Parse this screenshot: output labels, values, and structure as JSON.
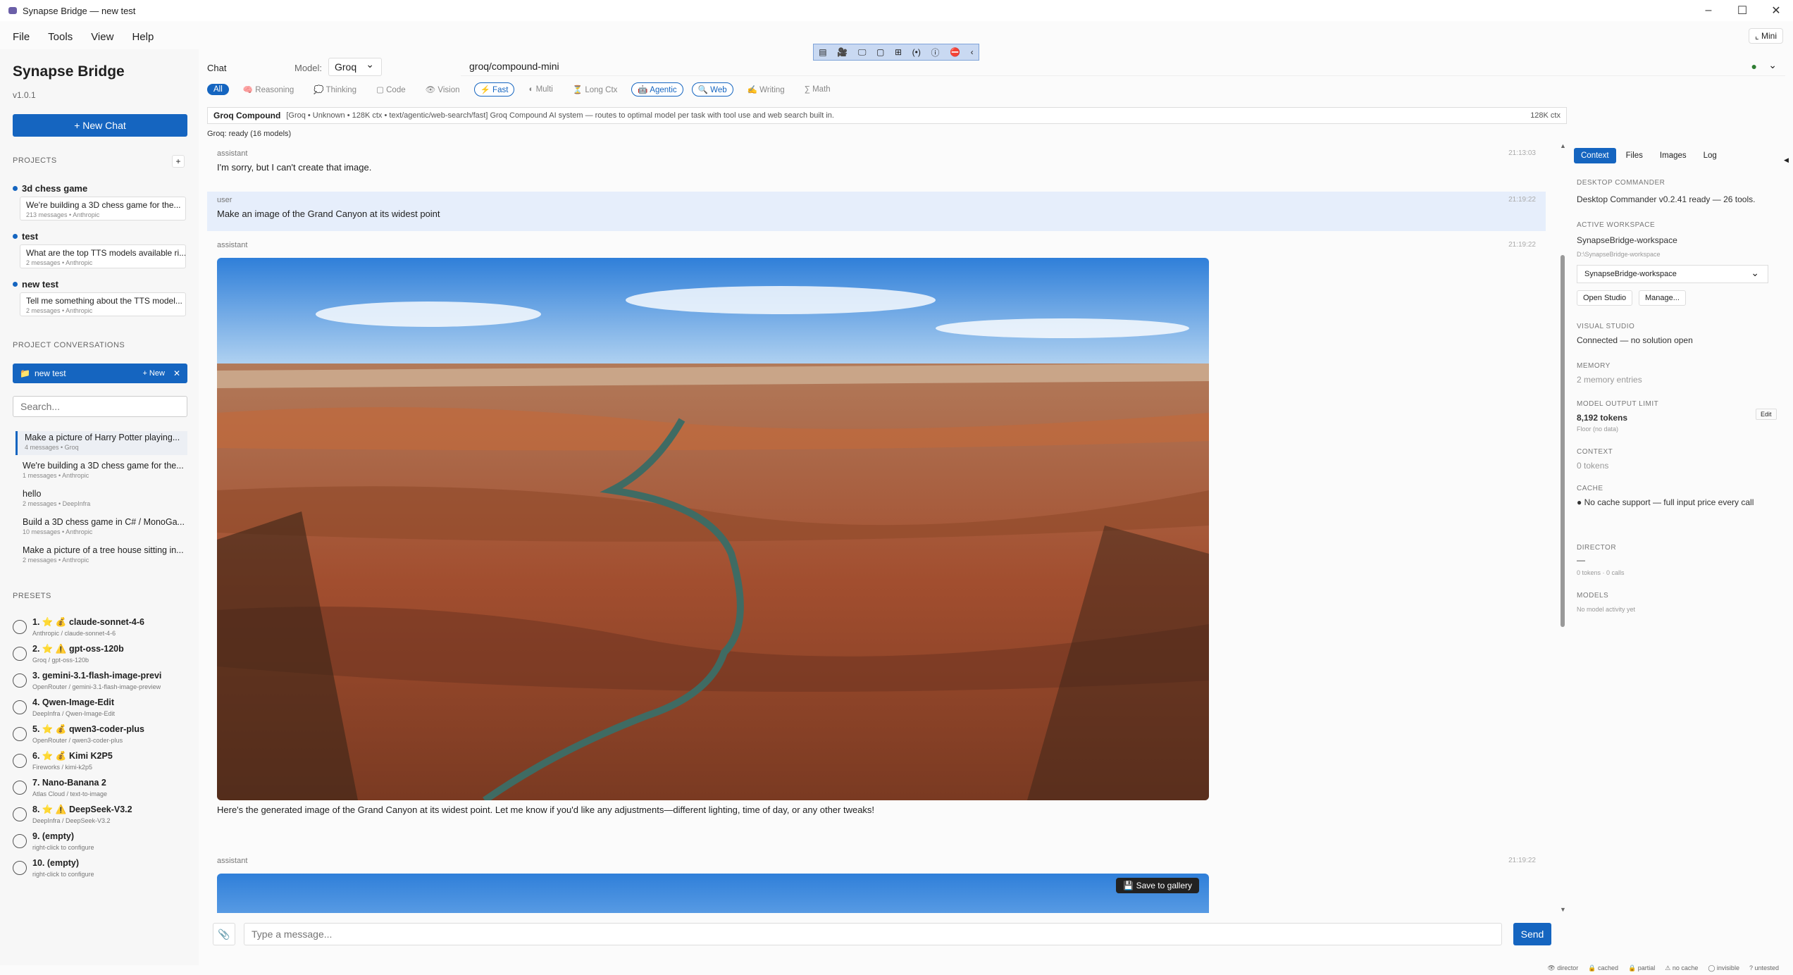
{
  "window": {
    "title": "Synapse Bridge — new test"
  },
  "menu": [
    "File",
    "Tools",
    "View",
    "Help"
  ],
  "mini": "⌞ Mini",
  "sidebar": {
    "brand": "Synapse Bridge",
    "version": "v1.0.1",
    "new_chat": "+ New Chat",
    "projects_header": "PROJECTS",
    "projects": [
      {
        "name": "3d chess game",
        "card": "We're building a 3D chess game for the...",
        "meta": "213 messages • Anthropic"
      },
      {
        "name": "test",
        "card": "What are the top TTS models available ri...",
        "meta": "2 messages • Anthropic"
      },
      {
        "name": "new test",
        "card": "Tell me something about the TTS model...",
        "meta": "2 messages • Anthropic"
      }
    ],
    "pc_header": "PROJECT CONVERSATIONS",
    "pc_bar": {
      "name": "new test",
      "new": "+ New",
      "close": "✕"
    },
    "search_placeholder": "Search...",
    "conversations": [
      {
        "t": "Make a picture of Harry Potter playing...",
        "m": "4 messages • Groq"
      },
      {
        "t": "We're building a 3D chess game for the...",
        "m": "1 messages • Anthropic"
      },
      {
        "t": "hello",
        "m": "2 messages • DeepInfra"
      },
      {
        "t": "Build a 3D chess game in C# / MonoGa...",
        "m": "10 messages • Anthropic"
      },
      {
        "t": "Make a picture of a tree house sitting in...",
        "m": "2 messages • Anthropic"
      }
    ],
    "presets_header": "PRESETS",
    "presets": [
      {
        "n": "1. ⭐ 💰 claude-sonnet-4-6",
        "s": "Anthropic / claude-sonnet-4-6"
      },
      {
        "n": "2. ⭐ ⚠️ gpt-oss-120b",
        "s": "Groq / gpt-oss-120b"
      },
      {
        "n": "3. gemini-3.1-flash-image-previ",
        "s": "OpenRouter / gemini-3.1-flash-image-preview"
      },
      {
        "n": "4. Qwen-Image-Edit",
        "s": "DeepInfra / Qwen-Image-Edit"
      },
      {
        "n": "5. ⭐ 💰 qwen3-coder-plus",
        "s": "OpenRouter / qwen3-coder-plus"
      },
      {
        "n": "6. ⭐ 💰 Kimi  K2P5",
        "s": "Fireworks / kimi-k2p5"
      },
      {
        "n": "7. Nano-Banana 2",
        "s": "Atlas Cloud / text-to-image"
      },
      {
        "n": "8. ⭐ ⚠️ DeepSeek-V3.2",
        "s": "DeepInfra / DeepSeek-V3.2"
      },
      {
        "n": "9. (empty)",
        "s": "right-click to configure"
      },
      {
        "n": "10. (empty)",
        "s": "right-click to configure"
      }
    ]
  },
  "header": {
    "chat": "Chat",
    "model_label": "Model:",
    "provider": "Groq",
    "model": "groq/compound-mini"
  },
  "toolstrip": [
    "▤",
    "🎥",
    "🖵",
    "▢",
    "⊞",
    "(•)",
    "ⓘ",
    "⛔",
    "‹"
  ],
  "filters": [
    {
      "label": "All",
      "state": "all"
    },
    {
      "label": "🧠 Reasoning",
      "state": "off"
    },
    {
      "label": "💭 Thinking",
      "state": "off"
    },
    {
      "label": "▢ Code",
      "state": "off"
    },
    {
      "label": "👁 Vision",
      "state": "off"
    },
    {
      "label": "⚡ Fast",
      "state": "on"
    },
    {
      "label": "◐ Multi",
      "state": "off"
    },
    {
      "label": "⏳ Long Ctx",
      "state": "off"
    },
    {
      "label": "🤖 Agentic",
      "state": "on"
    },
    {
      "label": "🔍 Web",
      "state": "on"
    },
    {
      "label": "✍ Writing",
      "state": "off"
    },
    {
      "label": "∑ Math",
      "state": "off"
    }
  ],
  "info": {
    "name": "Groq Compound",
    "details": "[Groq  •  Unknown  •  128K ctx • text/agentic/web-search/fast]  Groq Compound AI system — routes to optimal model per task with tool use and web search built in.",
    "ctx": "128K ctx"
  },
  "ready": "Groq: ready (16 models)",
  "messages": [
    {
      "role": "assistant",
      "time": "21:13:03",
      "text": "I'm sorry, but I can't create that image."
    },
    {
      "role": "user",
      "time": "21:19:22",
      "text": "Make an image of the Grand Canyon at its widest point"
    },
    {
      "role": "assistant",
      "time": "21:19:22",
      "text": "Here's the generated image of the Grand Canyon at its widest point. Let me know if you'd like any adjustments—different lighting, time of day, or any other tweaks!"
    },
    {
      "role": "assistant",
      "time": "21:19:22",
      "save": "💾 Save to gallery"
    }
  ],
  "input": {
    "attach": "📎",
    "placeholder": "Type a message...",
    "send": "Send"
  },
  "right": {
    "tabs": [
      "Context",
      "Files",
      "Images",
      "Log"
    ],
    "dc_h": "DESKTOP COMMANDER",
    "dc_v": "Desktop Commander v0.2.41 ready — 26 tools.",
    "ws_h": "ACTIVE WORKSPACE",
    "ws_v": "SynapseBridge-workspace",
    "ws_path": "D:\\SynapseBridge-workspace",
    "ws_drop": "SynapseBridge-workspace",
    "open_studio": "Open Studio",
    "manage": "Manage...",
    "vs_h": "VISUAL STUDIO",
    "vs_v": "Connected — no solution open",
    "mem_h": "MEMORY",
    "mem_v": "2 memory entries",
    "mol_h": "MODEL OUTPUT LIMIT",
    "mol_v": "8,192 tokens",
    "mol_sub": "Floor (no data)",
    "edit": "Edit",
    "ctx_h": "CONTEXT",
    "ctx_v": "0 tokens",
    "cache_h": "CACHE",
    "cache_v": "● No cache support — full input price every call",
    "dir_h": "DIRECTOR",
    "dir_v": "—",
    "dir_sub": "0 tokens · 0 calls",
    "models_h": "MODELS",
    "models_v": "No model activity yet"
  },
  "statusbar": [
    "👁 director",
    "🔒 cached",
    "🔒 partial",
    "⚠ no cache",
    "◯ invisible",
    "? untested"
  ]
}
